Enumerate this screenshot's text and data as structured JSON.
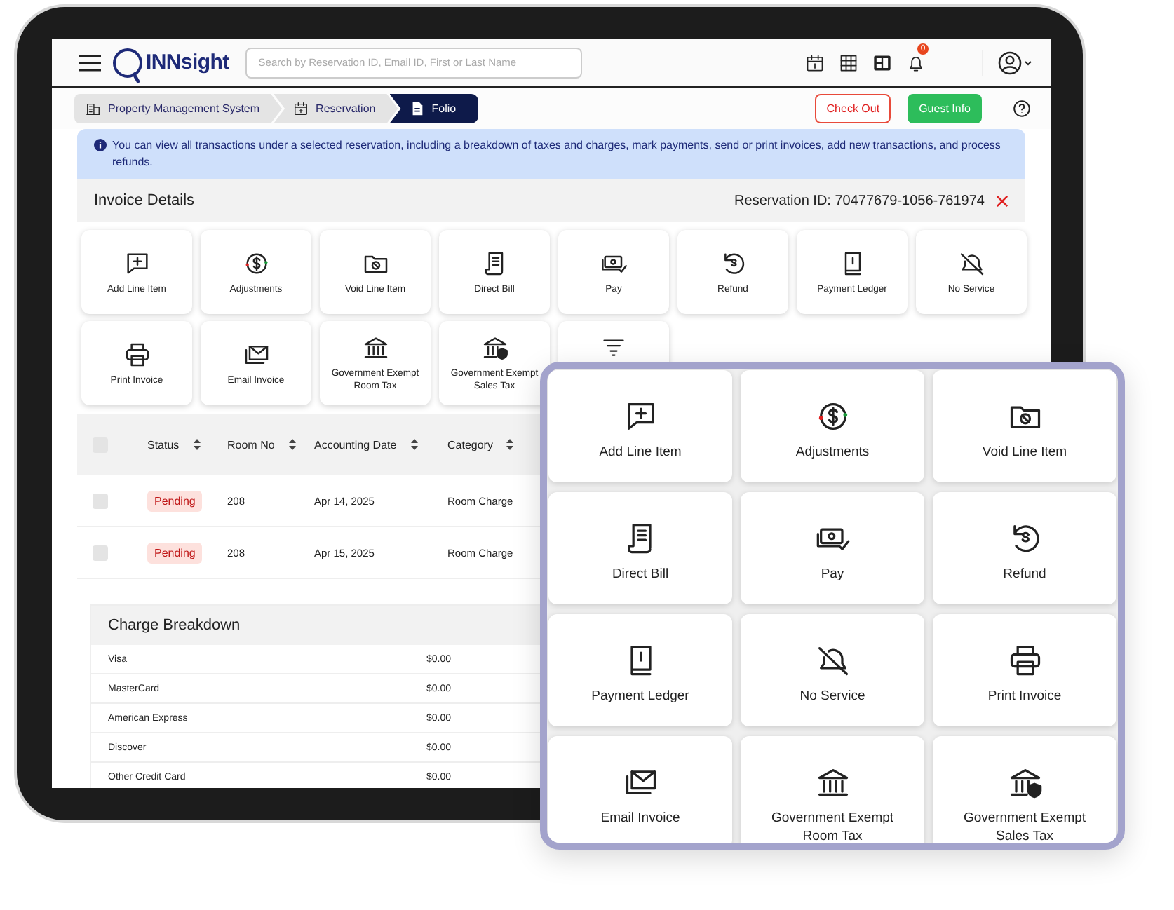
{
  "header": {
    "logo": "INNsight",
    "search": {
      "placeholder": "Search by Reservation ID, Email ID, First or Last Name"
    },
    "notification_count": "0"
  },
  "breadcrumb": [
    {
      "label": "Property Management System",
      "selected": false
    },
    {
      "label": "Reservation",
      "selected": false
    },
    {
      "label": "Folio",
      "selected": true
    }
  ],
  "actions": [
    {
      "label": "Check Out",
      "kind": "outline"
    },
    {
      "label": "Guest Info",
      "kind": "solid"
    }
  ],
  "info": "You can view all transactions under a selected reservation, including a breakdown of taxes and charges, mark payments, send or print invoices, add new transactions, and process refunds.",
  "invoice": {
    "title": "Invoice Details",
    "reservation_id": "Reservation ID: 70477679-1056-761974"
  },
  "tiles": [
    "Add Line Item",
    "Adjustments",
    "Void Line Item",
    "Direct Bill",
    "Pay",
    "Refund",
    "Payment Ledger",
    "No Service",
    "Print Invoice",
    "Email Invoice",
    "Government Exempt Room Tax",
    "Government Exempt Sales Tax"
  ],
  "table": {
    "all_selected": false,
    "columns": [
      "Status",
      "Room No",
      "Accounting Date",
      "Category"
    ],
    "rows": [
      {
        "selected": false,
        "status": "Pending",
        "room_no": "208",
        "date": "Apr 14, 2025",
        "category": "Room Charge"
      },
      {
        "selected": false,
        "status": "Pending",
        "room_no": "208",
        "date": "Apr 15, 2025",
        "category": "Room Charge"
      }
    ]
  },
  "charge_breakdown": {
    "title": "Charge Breakdown",
    "rows": [
      {
        "label": "Visa",
        "amount": "$0.00"
      },
      {
        "label": "MasterCard",
        "amount": "$0.00"
      },
      {
        "label": "American Express",
        "amount": "$0.00"
      },
      {
        "label": "Discover",
        "amount": "$0.00"
      },
      {
        "label": "Other Credit Card",
        "amount": "$0.00"
      }
    ]
  },
  "overlay": {
    "tiles": [
      "Add Line Item",
      "Adjustments",
      "Void Line Item",
      "Direct Bill",
      "Pay",
      "Refund",
      "Payment Ledger",
      "No Service",
      "Print Invoice",
      "Email Invoice",
      "Government Exempt Room Tax",
      "Government Exempt Sales Tax"
    ]
  }
}
